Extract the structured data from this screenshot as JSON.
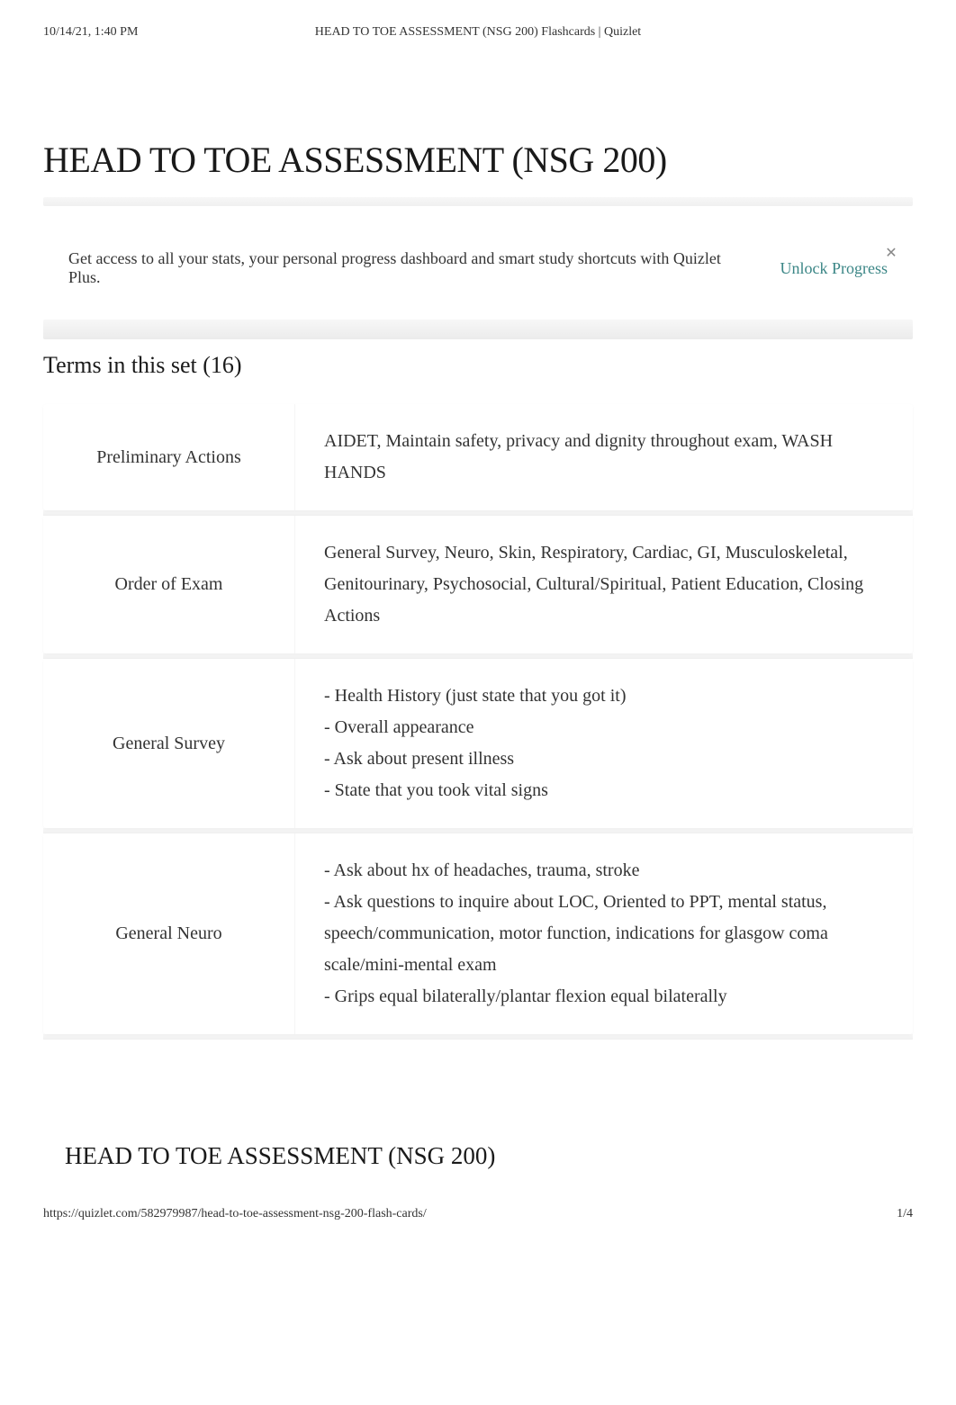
{
  "header": {
    "timestamp": "10/14/21, 1:40 PM",
    "page_title_header": "HEAD TO TOE ASSESSMENT (NSG 200) Flashcards | Quizlet"
  },
  "title": "HEAD TO TOE ASSESSMENT (NSG 200)",
  "promo": {
    "text": "Get access to all your stats, your personal progress dashboard and smart study shortcuts with Quizlet Plus.",
    "cta": "Unlock Progress",
    "close_glyph": "✕"
  },
  "section_heading": "Terms in this set (16)",
  "cards": [
    {
      "term": "Preliminary Actions",
      "definition": "AIDET, Maintain safety, privacy and dignity throughout exam, WASH HANDS"
    },
    {
      "term": "Order of Exam",
      "definition": "General Survey, Neuro, Skin, Respiratory, Cardiac, GI, Musculoskeletal, Genitourinary, Psychosocial, Cultural/Spiritual, Patient Education, Closing Actions"
    },
    {
      "term": "General Survey",
      "definition": "- Health History (just state that you got it)\n- Overall appearance\n- Ask about present illness\n- State that you took vital signs"
    },
    {
      "term": "General Neuro",
      "definition": "- Ask about hx of headaches, trauma, stroke\n- Ask questions to inquire about LOC, Oriented to PPT, mental status, speech/communication, motor function, indications for glasgow coma scale/mini-mental exam\n- Grips equal bilaterally/plantar flexion equal bilaterally"
    }
  ],
  "footer_title": "HEAD TO TOE ASSESSMENT (NSG 200)",
  "footer": {
    "url": "https://quizlet.com/582979987/head-to-toe-assessment-nsg-200-flash-cards/",
    "page_num": "1/4"
  }
}
